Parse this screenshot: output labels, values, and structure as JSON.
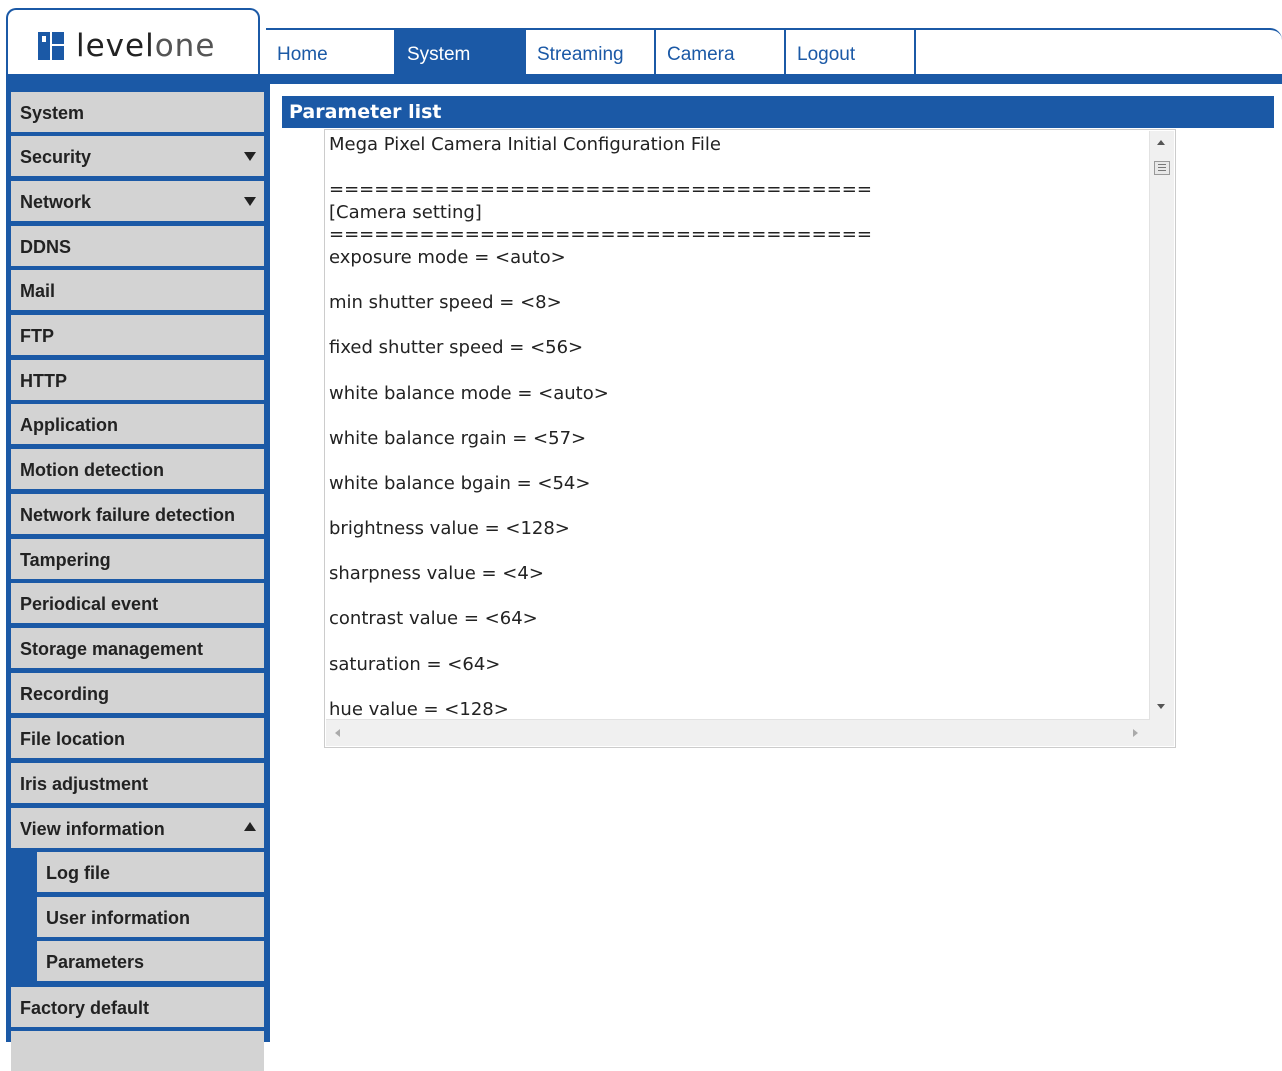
{
  "brand": {
    "logo_text_bold": "level",
    "logo_text_light": "one"
  },
  "nav": {
    "tabs": [
      {
        "label": "Home"
      },
      {
        "label": "System",
        "active": true
      },
      {
        "label": "Streaming"
      },
      {
        "label": "Camera"
      },
      {
        "label": "Logout"
      }
    ]
  },
  "sidebar": {
    "items": [
      {
        "label": "System"
      },
      {
        "label": "Security",
        "indicator": "down"
      },
      {
        "label": "Network",
        "indicator": "down"
      },
      {
        "label": "DDNS"
      },
      {
        "label": "Mail"
      },
      {
        "label": "FTP"
      },
      {
        "label": "HTTP"
      },
      {
        "label": "Application"
      },
      {
        "label": "Motion detection"
      },
      {
        "label": "Network failure detection"
      },
      {
        "label": "Tampering"
      },
      {
        "label": "Periodical event"
      },
      {
        "label": "Storage management"
      },
      {
        "label": "Recording"
      },
      {
        "label": "File location"
      },
      {
        "label": "Iris adjustment"
      },
      {
        "label": "View information",
        "indicator": "up"
      },
      {
        "label": "Log file",
        "sub": true
      },
      {
        "label": "User information",
        "sub": true
      },
      {
        "label": "Parameters",
        "sub": true
      },
      {
        "label": "Factory default"
      }
    ]
  },
  "panel": {
    "title": "Parameter list",
    "lines": [
      "Mega Pixel Camera Initial Configuration File",
      "",
      "====================================",
      "[Camera setting]",
      "====================================",
      "exposure mode = <auto>",
      "",
      "min shutter speed = <8>",
      "",
      "fixed shutter speed = <56>",
      "",
      "white balance mode = <auto>",
      "",
      "white balance rgain = <57>",
      "",
      "white balance bgain = <54>",
      "",
      "brightness value = <128>",
      "",
      "sharpness value = <4>",
      "",
      "contrast value = <64>",
      "",
      "saturation = <64>",
      "",
      "hue value = <128>"
    ]
  },
  "colors": {
    "accent": "#1b59a6",
    "menu_bg": "#d3d3d3"
  }
}
